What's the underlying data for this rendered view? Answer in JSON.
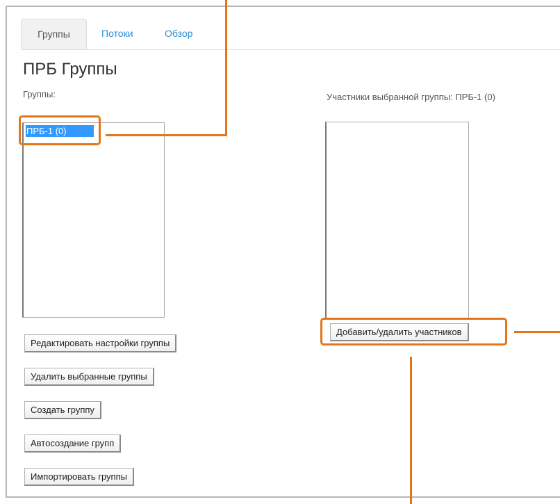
{
  "tabs": [
    {
      "label": "Группы",
      "active": true
    },
    {
      "label": "Потоки",
      "active": false
    },
    {
      "label": "Обзор",
      "active": false
    }
  ],
  "page": {
    "title": "ПРБ Группы",
    "groups_label": "Группы:",
    "members_label": "Участники выбранной группы: ПРБ-1 (0)"
  },
  "groups_list": {
    "items": [
      {
        "label": "ПРБ-1 (0)",
        "selected": true
      }
    ]
  },
  "members_list": {
    "items": []
  },
  "buttons": {
    "add_remove_members": "Добавить/удалить участников",
    "edit_group_settings": "Редактировать настройки группы",
    "delete_selected_groups": "Удалить выбранные группы",
    "create_group": "Создать группу",
    "auto_create_groups": "Автосоздание групп",
    "import_groups": "Импортировать группы"
  },
  "colors": {
    "accent_link": "#2a8fd6",
    "selection": "#3399ff",
    "callout": "#e3761a"
  }
}
